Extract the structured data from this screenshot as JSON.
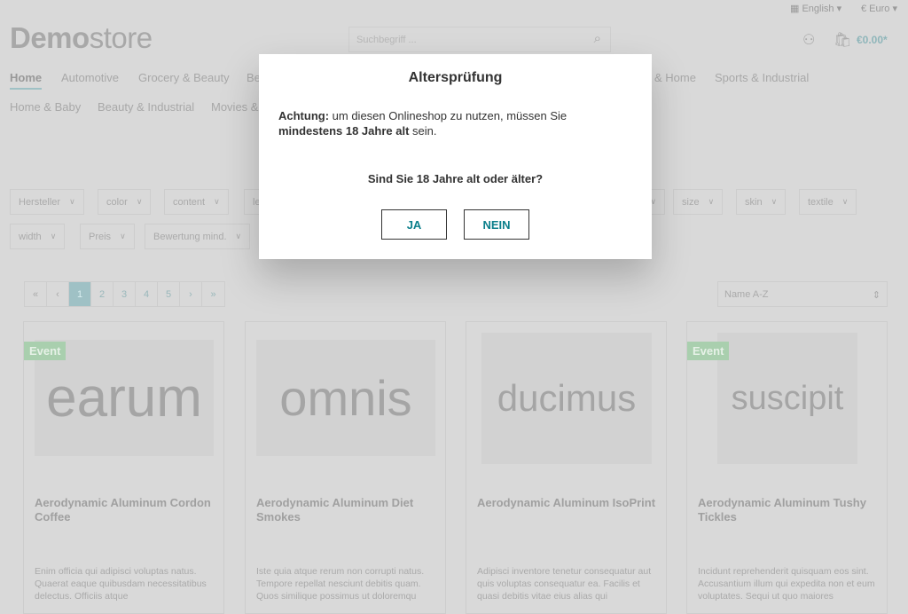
{
  "topbar": {
    "language": "English",
    "currency": "€ Euro"
  },
  "logo": {
    "bold": "Demo",
    "light": "store"
  },
  "search": {
    "placeholder": "Suchbegriff ..."
  },
  "cart": {
    "total": "€0.00*"
  },
  "nav": {
    "row1": [
      "Home",
      "Automotive",
      "Grocery & Beauty",
      "Be",
      "& Home",
      "Sports & Industrial"
    ],
    "row2": [
      "Home & Baby",
      "Beauty & Industrial",
      "Movies &"
    ]
  },
  "filters": {
    "row1": [
      "Hersteller",
      "color",
      "content",
      "le",
      "",
      "size",
      "skin",
      "textile"
    ],
    "row2": [
      "width",
      "Preis",
      "Bewertung mind."
    ]
  },
  "pagination": {
    "items": [
      "«",
      "‹",
      "1",
      "2",
      "3",
      "4",
      "5",
      "›",
      "»"
    ],
    "active": "1"
  },
  "sort": {
    "value": "Name A-Z"
  },
  "products": [
    {
      "image_text": "earum",
      "badge": "Event",
      "title": "Aerodynamic Aluminum Cordon Coffee",
      "desc": "Enim officia qui adipisci voluptas natus. Quaerat eaque quibusdam necessitatibus delectus. Officiis atque"
    },
    {
      "image_text": "omnis",
      "badge": "",
      "title": "Aerodynamic Aluminum Diet Smokes",
      "desc": "Iste quia atque rerum non corrupti natus. Tempore repellat nesciunt debitis quam. Quos similique possimus ut doloremqu"
    },
    {
      "image_text": "ducimus",
      "badge": "",
      "title": "Aerodynamic Aluminum IsoPrint",
      "desc": "Adipisci inventore tenetur consequatur aut quis voluptas consequatur ea. Facilis et quasi debitis vitae eius alias qui"
    },
    {
      "image_text": "suscipit",
      "badge": "Event",
      "title": "Aerodynamic Aluminum Tushy Tickles",
      "desc": "Incidunt reprehenderit quisquam eos sint. Accusantium illum qui expedita non et eum voluptates. Sequi ut quo maiores"
    }
  ],
  "modal": {
    "title": "Altersprüfung",
    "warn_bold": "Achtung:",
    "warn_text": " um diesen Onlineshop zu nutzen, müssen Sie ",
    "age_bold": "mindestens 18 Jahre alt",
    "age_text": " sein.",
    "question": "Sind Sie 18 Jahre alt oder älter?",
    "yes": "JA",
    "no": "NEIN"
  }
}
